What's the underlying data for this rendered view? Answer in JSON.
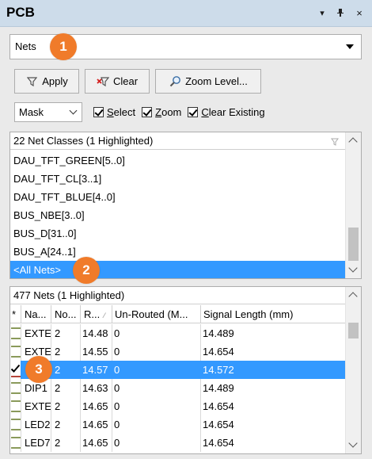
{
  "panel": {
    "title": "PCB",
    "pin_glyph": "▾",
    "dock_glyph": "⊥",
    "close_glyph": "×"
  },
  "mode_dropdown": {
    "value": "Nets"
  },
  "badges": {
    "one": "1",
    "two": "2",
    "three": "3"
  },
  "toolbar": {
    "apply_label": "Apply",
    "clear_label": "Clear",
    "zoom_level_label": "Zoom Level..."
  },
  "options": {
    "mode_select": "Mask",
    "select_label_u": "S",
    "select_label_rest": "elect",
    "zoom_label_u": "Z",
    "zoom_label_rest": "oom",
    "clear_existing_u": "C",
    "clear_existing_rest": "lear Existing",
    "select_checked": true,
    "zoom_checked": true,
    "clear_existing_checked": true
  },
  "net_classes": {
    "header": "22 Net Classes (1 Highlighted)",
    "items": [
      {
        "label": "DAU_TFT_GREEN[5..0]",
        "selected": false
      },
      {
        "label": "DAU_TFT_CL[3..1]",
        "selected": false
      },
      {
        "label": "DAU_TFT_BLUE[4..0]",
        "selected": false
      },
      {
        "label": "BUS_NBE[3..0]",
        "selected": false
      },
      {
        "label": "BUS_D[31..0]",
        "selected": false
      },
      {
        "label": "BUS_A[24..1]",
        "selected": false
      },
      {
        "label": "<All Nets>",
        "selected": true
      }
    ]
  },
  "nets": {
    "header": "477 Nets (1 Highlighted)",
    "columns": [
      "*",
      "Na...",
      "No...",
      "R...",
      "Un-Routed (M...",
      "Signal Length (mm)"
    ],
    "rows": [
      {
        "name": "EXTEI",
        "nodes": "2",
        "routed": "14.48",
        "unrouted": "0",
        "signal_length": "14.489",
        "checked": false,
        "selected": false
      },
      {
        "name": "EXTEI",
        "nodes": "2",
        "routed": "14.55",
        "unrouted": "0",
        "signal_length": "14.654",
        "checked": false,
        "selected": false
      },
      {
        "name": "",
        "nodes": "2",
        "routed": "14.57",
        "unrouted": "0",
        "signal_length": "14.572",
        "checked": true,
        "selected": true
      },
      {
        "name": "DIP1",
        "nodes": "2",
        "routed": "14.63",
        "unrouted": "0",
        "signal_length": "14.489",
        "checked": false,
        "selected": false
      },
      {
        "name": "EXTEI",
        "nodes": "2",
        "routed": "14.65",
        "unrouted": "0",
        "signal_length": "14.654",
        "checked": false,
        "selected": false
      },
      {
        "name": "LED2",
        "nodes": "2",
        "routed": "14.65",
        "unrouted": "0",
        "signal_length": "14.654",
        "checked": false,
        "selected": false
      },
      {
        "name": "LED7",
        "nodes": "2",
        "routed": "14.65",
        "unrouted": "0",
        "signal_length": "14.654",
        "checked": false,
        "selected": false
      }
    ]
  },
  "colors": {
    "selection": "#3399ff",
    "badge": "#f07b2a",
    "titlebar": "#cddcea",
    "swatch_green": "#8a9a5b",
    "swatch_red": "#b5463c"
  }
}
